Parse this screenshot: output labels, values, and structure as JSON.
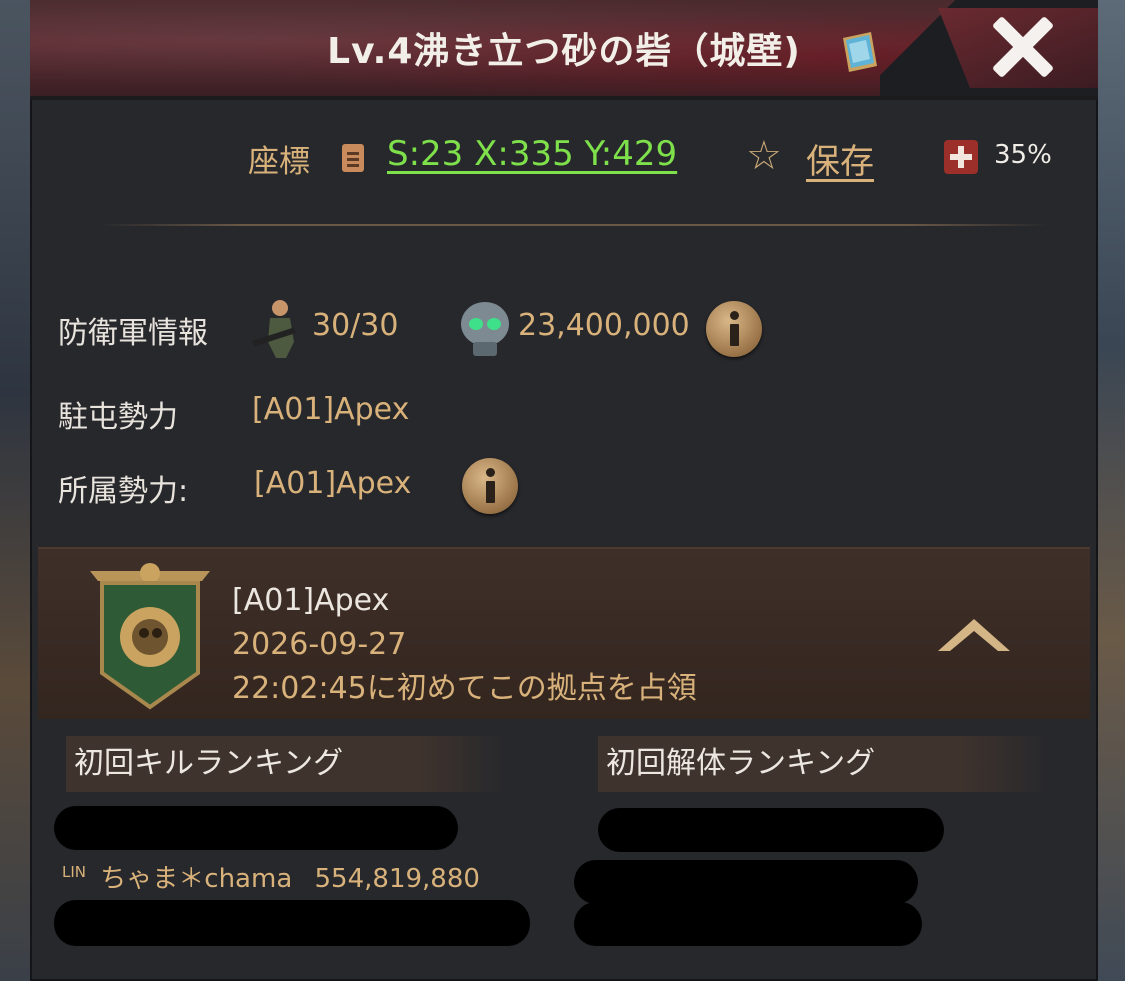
{
  "window": {
    "title": "Lv.4沸き立つ砂の砦（城壁)",
    "close_icon": "close-icon"
  },
  "coordinates": {
    "label": "座標",
    "value": "S:23 X:335 Y:429",
    "save_label": "保存",
    "bonus": "35%"
  },
  "info": {
    "defense_label": "防衛軍情報",
    "troops": "30/30",
    "power": "23,400,000",
    "garrison_label": "駐屯勢力",
    "garrison_value": "[A01]Apex",
    "affiliation_label": "所属勢力:",
    "affiliation_value": "[A01]Apex"
  },
  "occupation": {
    "alliance": "[A01]Apex",
    "date": "2026-09-27",
    "description": "22:02:45に初めてこの拠点を占領"
  },
  "rankings": {
    "kill_title": "初回キルランキング",
    "dismantle_title": "初回解体ランキング",
    "kill_entries": [
      {
        "tag": "LIN",
        "name": "ちゃま＊chama",
        "score": "554,819,880"
      }
    ]
  },
  "colors": {
    "accent_gold": "#d8b27a",
    "coord_green": "#7ee04a",
    "panel_bg": "#27282c",
    "title_red": "#5b2a30"
  }
}
